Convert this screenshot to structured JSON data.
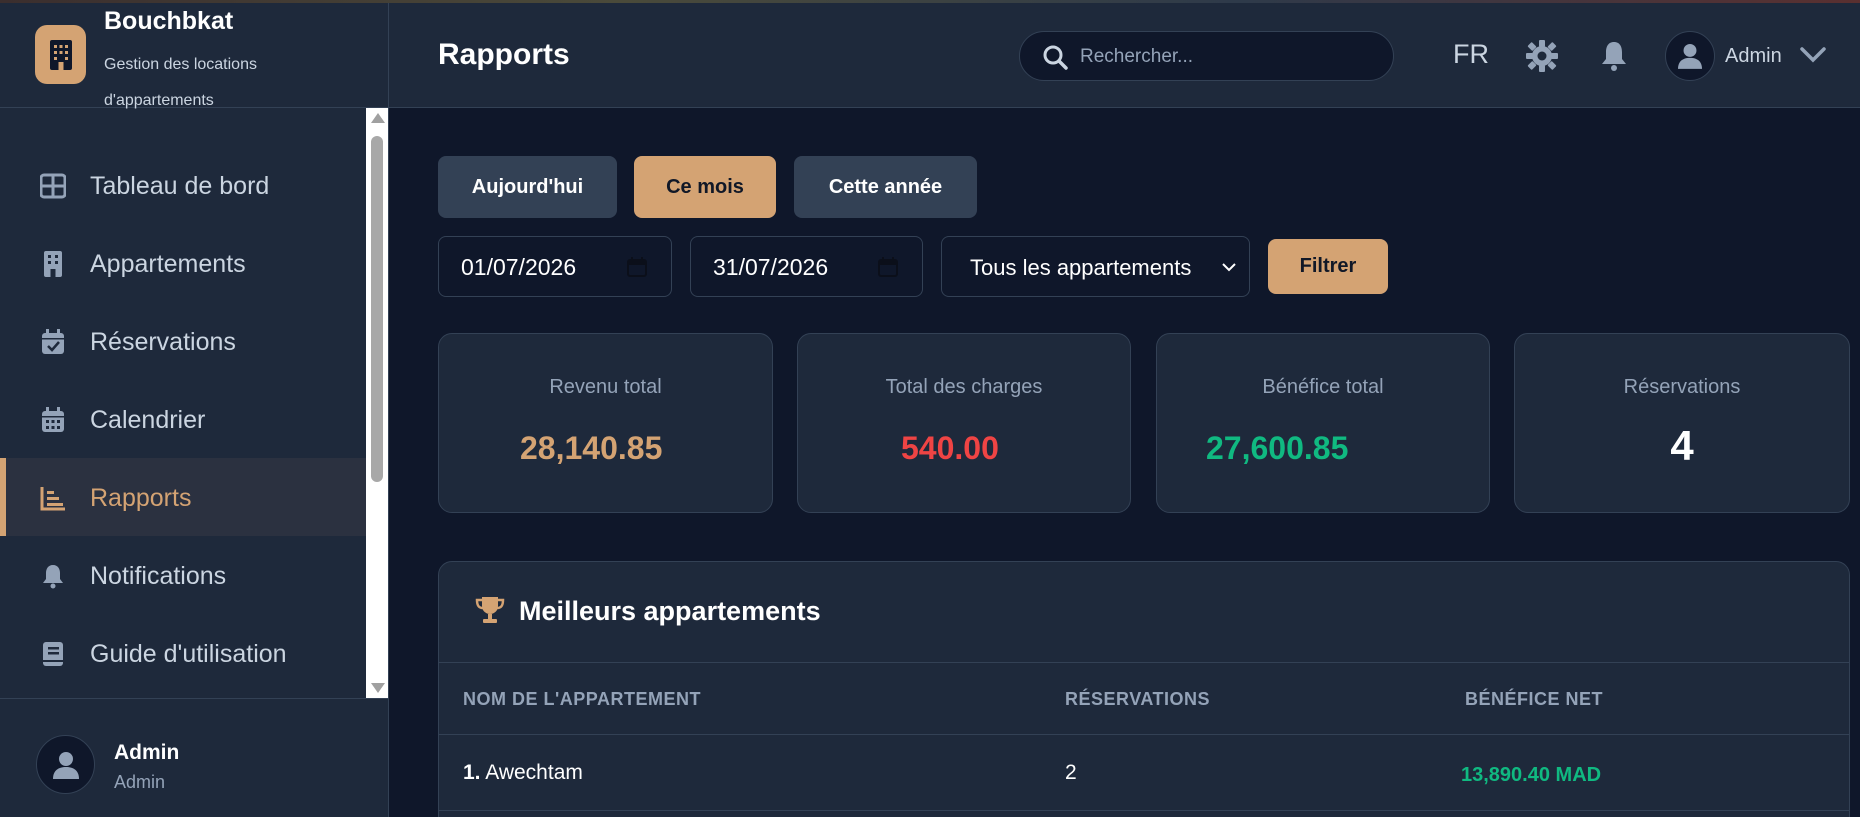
{
  "brand": {
    "title": "Bouchbkat",
    "subtitle": "Gestion des locations d'appartements"
  },
  "nav": {
    "items": [
      {
        "label": "Tableau de bord",
        "icon": "grid-icon"
      },
      {
        "label": "Appartements",
        "icon": "building-icon"
      },
      {
        "label": "Réservations",
        "icon": "calendar-check-icon"
      },
      {
        "label": "Calendrier",
        "icon": "calendar-icon"
      },
      {
        "label": "Rapports",
        "icon": "chart-icon",
        "active": true
      },
      {
        "label": "Notifications",
        "icon": "bell-icon"
      },
      {
        "label": "Guide d'utilisation",
        "icon": "book-icon"
      }
    ]
  },
  "sidebar_user": {
    "name": "Admin",
    "role": "Admin"
  },
  "header": {
    "title": "Rapports",
    "search_placeholder": "Rechercher...",
    "lang": "FR",
    "user": "Admin"
  },
  "period_buttons": {
    "today": "Aujourd'hui",
    "month": "Ce mois",
    "year": "Cette année"
  },
  "filters": {
    "start_date": "01/07/2026",
    "end_date": "31/07/2026",
    "apartment_select": "Tous les appartements",
    "filter_button": "Filtrer"
  },
  "stats": [
    {
      "label": "Revenu total",
      "value": "28,140.85",
      "color": "#d4a373"
    },
    {
      "label": "Total des charges",
      "value": "540.00",
      "color": "#ef4444"
    },
    {
      "label": "Bénéfice total",
      "value": "27,600.85",
      "color": "#10b981"
    },
    {
      "label": "Réservations",
      "value": "4",
      "color": "#ffffff"
    }
  ],
  "best_apartments": {
    "title": "Meilleurs appartements",
    "columns": [
      "NOM DE L'APPARTEMENT",
      "RÉSERVATIONS",
      "BÉNÉFICE NET"
    ],
    "rows": [
      {
        "rank": "1.",
        "name": "Awechtam",
        "reservations": "2",
        "net": "13,890.40 MAD"
      }
    ]
  },
  "colors": {
    "accent": "#d4a373",
    "background": "#0f172a",
    "panel": "#1e293b",
    "positive": "#10b981",
    "negative": "#ef4444"
  }
}
